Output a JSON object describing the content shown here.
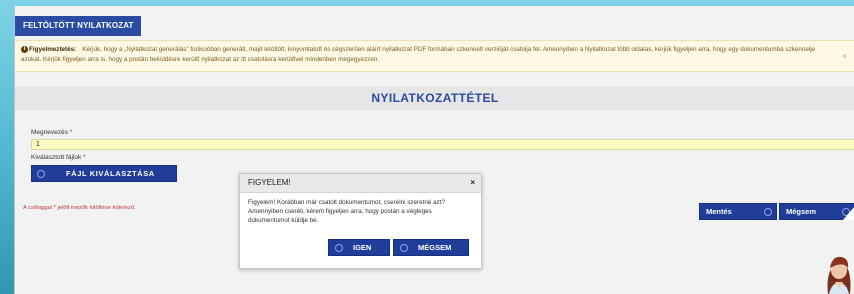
{
  "tab": {
    "label": "FELTÖLTÖTT NYILATKOZAT"
  },
  "notice": {
    "label": "Figyelmeztetés:",
    "text": "Kérjük, hogy a „Nyilatkozat generálás” funkcióban generált, majd letöltött, kinyomtatott és cégszerűen aláírt nyilatkozat PDF formában szkennelt verzióját csatolja fel. Amennyiben a Nyilatkozat több oldalas, kérjük figyeljen arra, hogy egy dokumentumba szkennelje azokat. Kérjük figyeljen arra is, hogy a postán beküldésre kerülő nyilatkozat az itt csatolásra kerülővel mindenben megegyezzen.",
    "close": "×"
  },
  "section": {
    "title": "NYILATKOZATTÉTEL"
  },
  "form": {
    "name_label": "Megnevezés",
    "name_value": "1",
    "files_label": "Kiválasztott fájlok",
    "required_mark": "*",
    "file_button": "FÁJL KIVÁLASZTÁSA",
    "hint": "A csillaggal * jelölt mezők kitöltése kötelező."
  },
  "actions": {
    "save": "Mentés",
    "cancel": "Mégsem"
  },
  "dialog": {
    "title": "FIGYELEM!",
    "close": "×",
    "message": "Figyelem! Korábban már csatolt dokumentumot, cserélni szeretné azt? Amennyiben cseréli, kérem figyeljen arra, hogy postán a végleges dokumentumot küldje be.",
    "yes": "IGEN",
    "no": "MÉGSEM"
  },
  "colors": {
    "accent": "#2a4aa3",
    "button": "#1f3d99",
    "input_bg": "#ffffc0",
    "required": "#d12020"
  }
}
